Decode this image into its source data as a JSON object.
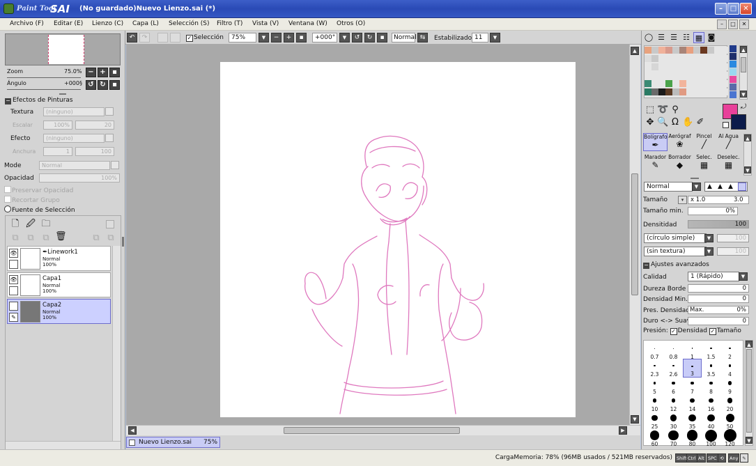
{
  "window": {
    "app_name_1": "Paint Tool",
    "app_name_2": "SAI",
    "title": "(No guardado)Nuevo Lienzo.sai (*)",
    "btn_min": "–",
    "btn_max": "□",
    "btn_close": "✕"
  },
  "menu": [
    "Archivo (F)",
    "Editar (E)",
    "Lienzo (C)",
    "Capa (L)",
    "Selección (S)",
    "Filtro (T)",
    "Vista (V)",
    "Ventana (W)",
    "Otros (O)"
  ],
  "navigator": {
    "zoom_label": "Zoom",
    "zoom_value": "75.0%",
    "angle_label": "Ángulo",
    "angle_value": "+000§"
  },
  "paint_effects": {
    "header": "Efectos de Pinturas",
    "texture_label": "Textura",
    "texture_value": "(ninguno)",
    "scale_label": "Escalar",
    "scale_value": "100%",
    "scale_num": "20",
    "effect_label": "Efecto",
    "effect_value": "(ninguno)",
    "width_label": "Anchura",
    "width_value": "1",
    "width_num": "100"
  },
  "layer_props": {
    "mode_label": "Mode",
    "mode_value": "Normal",
    "opacity_label": "Opacidad",
    "opacity_value": "100%",
    "preserve_opacity": "Preservar Opacidad",
    "clip_group": "Recortar Grupo",
    "selection_source": "Fuente de Selección"
  },
  "layers": [
    {
      "name": "Linework1",
      "mode": "Normal",
      "opacity": "100%",
      "visible": true,
      "selected": false
    },
    {
      "name": "Capa1",
      "mode": "Normal",
      "opacity": "100%",
      "visible": true,
      "selected": false
    },
    {
      "name": "Capa2",
      "mode": "Normal",
      "opacity": "100%",
      "visible": false,
      "selected": true
    }
  ],
  "toolbar": {
    "selection_label": "Selección",
    "zoom_value": "75%",
    "angle_value": "+000°",
    "blend_value": "Normal",
    "stabilizer_label": "Estabilizador",
    "stabilizer_value": "11"
  },
  "document_tab": {
    "name": "Nuevo Lienzo.sai",
    "zoom": "75%"
  },
  "color": {
    "primary": "#e8419a",
    "secondary": "#0b1b4a"
  },
  "brushes": [
    {
      "label": "Bolígrafo",
      "icon": "pen-icon",
      "glyph": "✒"
    },
    {
      "label": "Aerógraf",
      "icon": "airbrush-icon",
      "glyph": "❀"
    },
    {
      "label": "Pincel",
      "icon": "brush-icon",
      "glyph": "╱"
    },
    {
      "label": "Al Agua",
      "icon": "watercolor-icon",
      "glyph": "╱"
    },
    {
      "label": "Marador",
      "icon": "marker-icon",
      "glyph": "✎"
    },
    {
      "label": "Borrador",
      "icon": "eraser-icon",
      "glyph": "◆"
    },
    {
      "label": "Selec.",
      "icon": "select-brush-icon",
      "glyph": "▦"
    },
    {
      "label": "Deselec.",
      "icon": "deselect-brush-icon",
      "glyph": "▦"
    }
  ],
  "brush_settings": {
    "blend_mode": "Normal",
    "size_label": "Tamaño",
    "size_multiplier": "x 1.0",
    "size_value": "3.0",
    "min_size_label": "Tamaño min.",
    "min_size_value": "0%",
    "density_label": "Densitidad",
    "density_value": "100",
    "shape_value": "(círculo simple)",
    "shape_num": "100",
    "texture_value": "(sin textura)",
    "texture_num": "100",
    "advanced_header": "Ajustes avanzados",
    "quality_label": "Calidad",
    "quality_value": "1 (Rápido)",
    "edge_hardness_label": "Dureza Borde",
    "edge_hardness_value": "0",
    "min_density_label": "Densidad Min.",
    "min_density_value": "0",
    "max_density_pressure_label": "Pres. Densidad",
    "max_density_pressure_field": "Max.",
    "max_density_pressure_value": "0%",
    "hard_soft_label": "Duro <-> Suave",
    "hard_soft_value": "0",
    "pressure_label": "Presión:",
    "pressure_density": "Densidad",
    "pressure_size": "Tamaño"
  },
  "brush_sizes": [
    "0.7",
    "0.8",
    "1",
    "1.5",
    "2",
    "2.3",
    "2.6",
    "3",
    "3.5",
    "4",
    "5",
    "6",
    "7",
    "8",
    "9",
    "10",
    "12",
    "14",
    "16",
    "20",
    "25",
    "30",
    "35",
    "40",
    "50",
    "60",
    "70",
    "80",
    "100",
    "120"
  ],
  "status": {
    "memory": "CargaMemoria: 78% (96MB usados / 521MB reservados)",
    "keys": [
      "Shift",
      "Ctrl",
      "Alt",
      "SPC"
    ],
    "any": "Any"
  },
  "palette": [
    [
      "#e8a27e",
      "#c9c9c9",
      "#f0b19a",
      "#d89a8c",
      "#c9c9c9",
      "#a88478",
      "#e8a080",
      "#c9c9c9",
      "#6a3820",
      "#c9c9c9",
      "#e6e6e6",
      "#e6e6e6"
    ],
    [
      "#dcdcdc",
      "#c9c9c9",
      "#e6e6e6",
      "#e6e6e6",
      "#e6e6e6",
      "#e6e6e6",
      "#e6e6e6",
      "#e6e6e6",
      "#e6e6e6",
      "#e6e6e6",
      "#e6e6e6",
      "#e6e6e6"
    ],
    [
      "#e6e6e6",
      "#d6d6d6",
      "#e6e6e6",
      "#e6e6e6",
      "#e6e6e6",
      "#e6e6e6",
      "#e6e6e6",
      "#e6e6e6",
      "#e6e6e6",
      "#e6e6e6",
      "#e6e6e6",
      "#e6e6e6"
    ],
    [
      "#e6e6e6",
      "#e6e6e6",
      "#e6e6e6",
      "#e6e6e6",
      "#e6e6e6",
      "#e6e6e6",
      "#e6e6e6",
      "#e6e6e6",
      "#e6e6e6",
      "#e6e6e6",
      "#e6e6e6",
      "#e6e6e6"
    ],
    [
      "#3a8a74",
      "#e6e6e6",
      "#e6e6e6",
      "#4aa24a",
      "#e6e6e6",
      "#f2b49c",
      "#e6e6e6",
      "#e6e6e6",
      "#e6e6e6",
      "#e6e6e6",
      "#e6e6e6",
      "#e6e6e6"
    ],
    [
      "#2a7a64",
      "#6a6a6a",
      "#1a1a1a",
      "#5a3a24",
      "#bcbcbc",
      "#e09a82",
      "#e6e6e6",
      "#e6e6e6",
      "#e6e6e6",
      "#e6e6e6",
      "#e6e6e6",
      "#e6e6e6"
    ]
  ],
  "palette_side": [
    "#203a8a",
    "#1e2e6a",
    "#2a8ae0",
    "#9ad8f0",
    "#e84aa0",
    "#5a6aa8",
    "#4a74d0"
  ]
}
